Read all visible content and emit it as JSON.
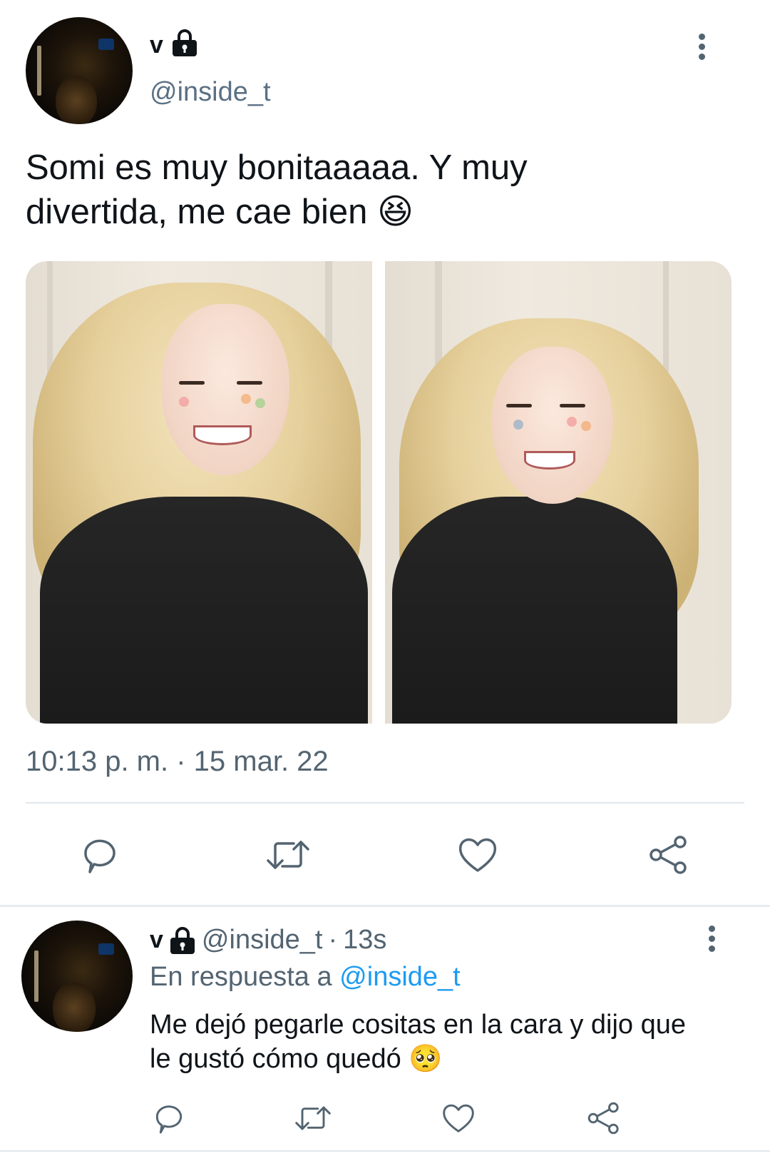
{
  "tweet": {
    "display_name": "v",
    "handle": "@inside_t",
    "text": "Somi es muy bonitaaaaa. Y muy divertida, me cae bien 😆",
    "timestamp": "10:13 p. m. · 15 mar. 22",
    "lock_icon": "lock-icon",
    "more_icon": "more-vertical-icon"
  },
  "actions": [
    "reply-icon",
    "retweet-icon",
    "like-icon",
    "share-icon"
  ],
  "reply": {
    "display_name": "v",
    "handle": "@inside_t",
    "separator": "·",
    "age": "13s",
    "in_reply_prefix": "En respuesta a",
    "in_reply_handle": "@inside_t",
    "text": "Me dejó pegarle cositas en la cara y dijo que le gustó cómo quedó 🥺"
  },
  "colors": {
    "link": "#1d9bf0",
    "secondary_text": "#536471",
    "icon": "#536471",
    "divider": "#e1e8ed"
  }
}
